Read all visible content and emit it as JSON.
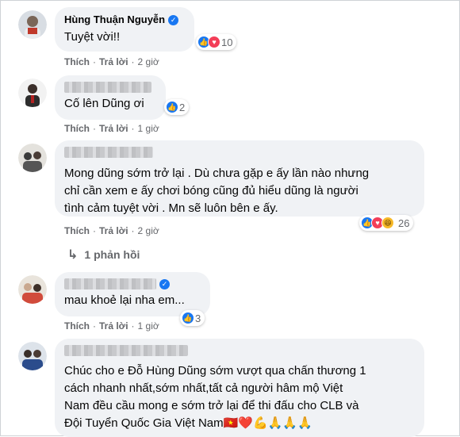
{
  "action_labels": {
    "like": "Thích",
    "reply": "Trả lời",
    "sep": "·"
  },
  "colors": {
    "bubble": "#f0f2f5",
    "like": "#1877f2",
    "love": "#f33e58",
    "haha": "#f7b928",
    "muted": "#65676b"
  },
  "comments": [
    {
      "author": "Hùng Thuận Nguyễn",
      "verified": true,
      "text": "Tuyệt vời!!",
      "time": "2 giờ",
      "reactions": {
        "icons": [
          "like-icon",
          "love-icon"
        ],
        "count": "10"
      }
    },
    {
      "author": "",
      "verified": false,
      "text": "Cố lên Dũng ơi",
      "time": "1 giờ",
      "reactions": {
        "icons": [
          "like-icon"
        ],
        "count": "2"
      }
    },
    {
      "author": "",
      "verified": false,
      "text": "Mong dũng sớm trở lại . Dù chưa gặp e ấy lần nào nhưng\nchỉ cần xem e ấy chơi bóng cũng đủ hiểu dũng là người\ntình cảm tuyệt vời . Mn sẽ luôn bên e ấy.",
      "time": "2 giờ",
      "reactions": {
        "icons": [
          "like-icon",
          "love-icon",
          "haha-icon"
        ],
        "count": "26"
      },
      "replies": "1 phản hồi"
    },
    {
      "author": "",
      "verified": true,
      "text": "mau khoẻ lại nha em...",
      "time": "1 giờ",
      "reactions": {
        "icons": [
          "like-icon"
        ],
        "count": "3"
      }
    },
    {
      "author": "",
      "verified": false,
      "text": "Chúc cho e Đỗ Hùng Dũng sớm vượt qua chấn thương 1\ncách nhanh nhất,sớm nhất,tất cả người hâm mộ Việt\nNam đều cầu mong e sớm trở lại để thi đấu cho CLB và\nĐội Tuyển Quốc Gia Việt Nam",
      "emoji": "🇻🇳❤️💪🙏🙏🙏"
    }
  ]
}
